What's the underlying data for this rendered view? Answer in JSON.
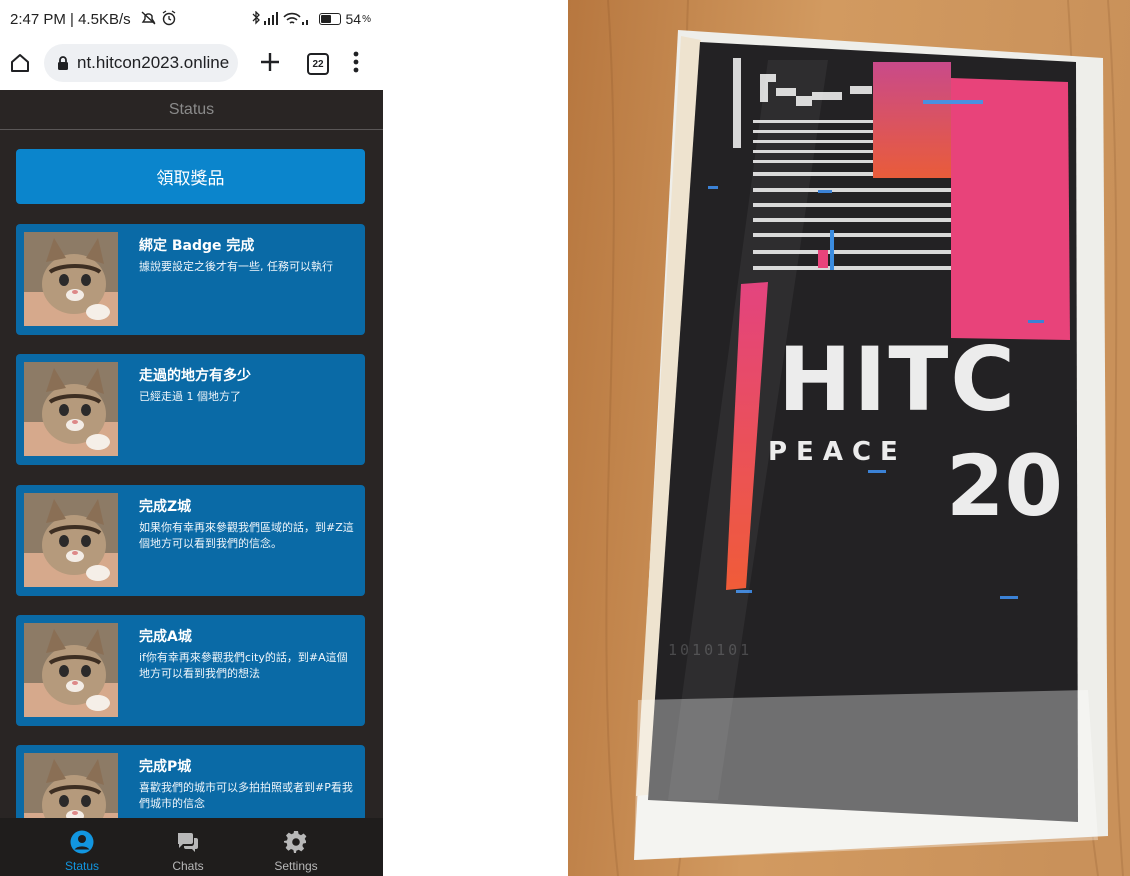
{
  "statusbar": {
    "time_speed": "2:47 PM | 4.5KB/s",
    "battery": "54"
  },
  "browser": {
    "url": "nt.hitcon2023.online",
    "tab_count": "22"
  },
  "app": {
    "title": "Status",
    "claim_button": "領取獎品",
    "cards": [
      {
        "title": "綁定 Badge 完成",
        "desc": "據說要設定之後才有一些, 任務可以執行"
      },
      {
        "title": "走過的地方有多少",
        "desc": "已經走過 1 個地方了"
      },
      {
        "title": "完成Z城",
        "desc": "如果你有幸再來參觀我們區域的話，到#Z這個地方可以看到我們的信念。"
      },
      {
        "title": "完成A城",
        "desc": "if你有幸再來參觀我們city的話，到#A這個地方可以看到我們的想法"
      },
      {
        "title": "完成P城",
        "desc": "喜歡我們的城市可以多拍拍照或者到#P看我們城市的信念"
      }
    ],
    "nav": [
      {
        "label": "Status",
        "icon": "person-icon",
        "active": true
      },
      {
        "label": "Chats",
        "icon": "chat-bubbles-icon",
        "active": false
      },
      {
        "label": "Settings",
        "icon": "gear-icon",
        "active": false
      }
    ]
  },
  "photo": {
    "logo_text": "HITC",
    "peace_text": "PEACE",
    "year_text": "20",
    "binary_text": "1010101"
  },
  "colors": {
    "app_bg": "#292524",
    "claim_blue": "#0b85cc",
    "card_blue": "#0a6aa6",
    "nav_active": "#1296e0",
    "pink": "#e83a76",
    "table": "#c88a52"
  }
}
